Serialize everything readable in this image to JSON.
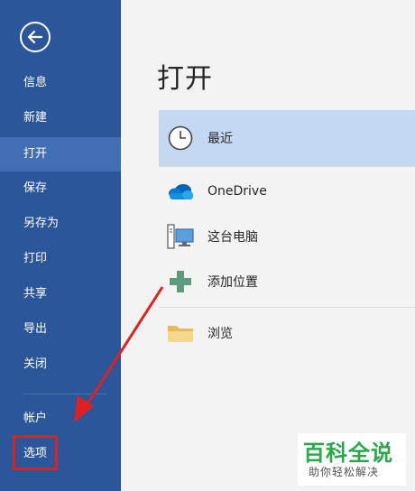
{
  "sidebar": {
    "items": [
      {
        "label": "信息"
      },
      {
        "label": "新建"
      },
      {
        "label": "打开"
      },
      {
        "label": "保存"
      },
      {
        "label": "另存为"
      },
      {
        "label": "打印"
      },
      {
        "label": "共享"
      },
      {
        "label": "导出"
      },
      {
        "label": "关闭"
      },
      {
        "label": "帐户"
      },
      {
        "label": "选项"
      }
    ],
    "active_index": 2
  },
  "main": {
    "title": "打开",
    "locations": [
      {
        "label": "最近",
        "icon": "clock-icon",
        "selected": true
      },
      {
        "label": "OneDrive",
        "icon": "cloud-icon"
      },
      {
        "label": "这台电脑",
        "icon": "computer-icon"
      },
      {
        "label": "添加位置",
        "icon": "plus-icon"
      },
      {
        "label": "浏览",
        "icon": "folder-icon"
      }
    ]
  },
  "watermark": {
    "main": "百科全说",
    "sub": "助你轻松解决"
  },
  "colors": {
    "sidebar": "#2b579a",
    "sidebar_active": "#426fb3",
    "selected_location": "#c5d8f2",
    "annotation": "#e02020",
    "watermark_text": "#2aa84a"
  }
}
